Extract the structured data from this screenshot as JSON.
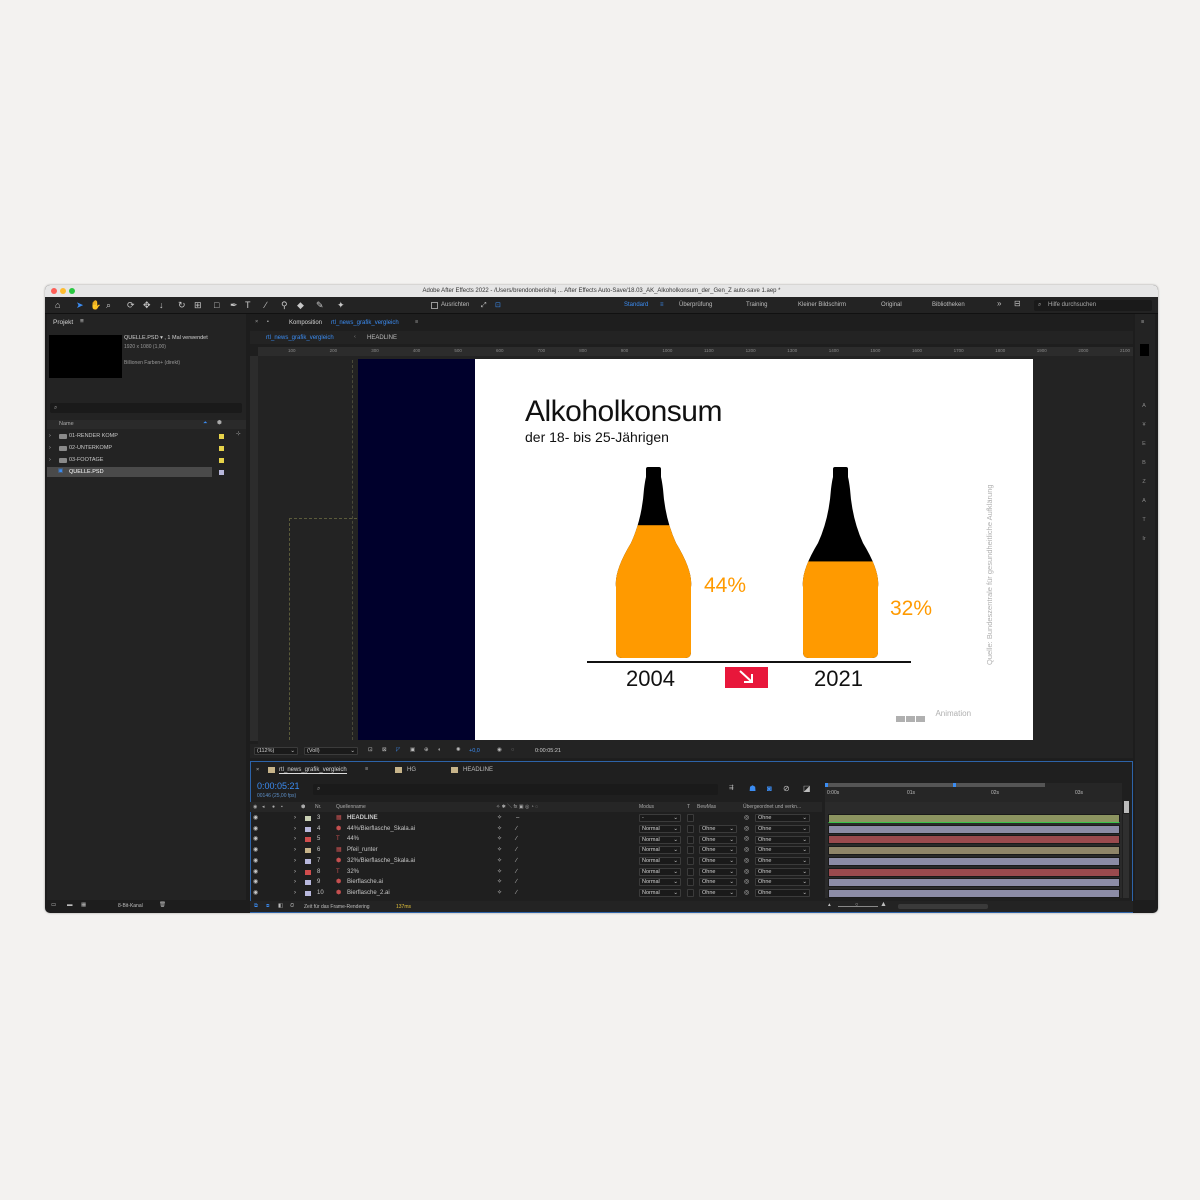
{
  "window": {
    "title": "Adobe After Effects 2022 - /Users/brendonberishaj ...  After Effects Auto-Save/18.03_AK_Alkoholkonsum_der_Gen_Z auto-save 1.aep *"
  },
  "toolbar": {
    "ausrichten": "Ausrichten",
    "workspaces": [
      "Standard",
      "Überprüfung",
      "Training",
      "Kleiner Bildschirm",
      "Original",
      "Bibliotheken"
    ],
    "help_placeholder": "Hilfe durchsuchen"
  },
  "project": {
    "title": "Projekt",
    "item_name": "QUELLE.PSD ▾ , 1 Mal verwendet",
    "item_size": "1920 x 1080 (1,00)",
    "item_colors": "Billionen Farben+ (direkt)",
    "col_name": "Name",
    "items": [
      "01-RENDER KOMP",
      "02-UNTERKOMP",
      "03-FOOTAGE",
      "QUELLE.PSD"
    ],
    "bit_depth": "8-Bit-Kanal"
  },
  "composition": {
    "panel_label": "Komposition",
    "name": "rtl_news_grafik_vergleich",
    "breadcrumb": [
      "rtl_news_grafik_vergleich",
      "HEADLINE"
    ],
    "ruler_labels": [
      "100",
      "200",
      "300",
      "400",
      "500",
      "600",
      "700",
      "800",
      "900",
      "1000",
      "1100",
      "1200",
      "1300",
      "1400",
      "1500",
      "1600",
      "1700",
      "1800",
      "1900",
      "2000",
      "2100"
    ],
    "zoom": "(112%)",
    "resolution": "(Voll)",
    "exposure": "+0,0",
    "timecode": "0:00:05:21"
  },
  "graphic": {
    "title": "Alkoholkonsum",
    "subtitle": "der 18- bis 25-Jährigen",
    "bottles": [
      {
        "year": "2004",
        "percent_label": "44%",
        "fill": 0.44
      },
      {
        "year": "2021",
        "percent_label": "32%",
        "fill": 0.32
      }
    ],
    "source": "Quelle: Bundeszentrale für gesundheitliche Aufklärung",
    "logo_text": "Animation",
    "colors": {
      "orange": "#ff9a00",
      "bottle": "#000000",
      "arrow_box": "#e8173b",
      "background": "#ffffff",
      "comp_bg": "#00002c"
    }
  },
  "timeline": {
    "tabs": [
      "rtl_news_grafik_vergleich",
      "HG",
      "HEADLINE"
    ],
    "timecode": "0:00:05:21",
    "fps": "00146 (25,00 fps)",
    "headers": {
      "nr": "Nr.",
      "source": "Quellenname",
      "mode": "Modus",
      "t": "T",
      "bewmas": "BewMas",
      "parent": "Übergeordnet und verkn..."
    },
    "time_markers": [
      "0:00s",
      "01s",
      "02s",
      "03s"
    ],
    "layers": [
      {
        "nr": "3",
        "name": "HEADLINE",
        "color": "#c9d0b4",
        "type": "comp",
        "mode": "-",
        "bewmas": "",
        "parent": "Ohne",
        "bar": "#8c9460"
      },
      {
        "nr": "4",
        "name": "44%/Bierflasche_Skala.ai",
        "color": "#b8b8dc",
        "type": "ai",
        "mode": "Normal",
        "bewmas": "Ohne",
        "parent": "Ohne",
        "bar": "#8c8ca6"
      },
      {
        "nr": "5",
        "name": "44%",
        "color": "#d04d4d",
        "type": "text",
        "mode": "Normal",
        "bewmas": "Ohne",
        "parent": "Ohne",
        "bar": "#9a4a4e"
      },
      {
        "nr": "6",
        "name": "Pfeil_runter",
        "color": "#c7b48a",
        "type": "comp",
        "mode": "Normal",
        "bewmas": "Ohne",
        "parent": "Ohne",
        "bar": "#8f8569"
      },
      {
        "nr": "7",
        "name": "32%/Bierflasche_Skala.ai",
        "color": "#b8b8dc",
        "type": "ai",
        "mode": "Normal",
        "bewmas": "Ohne",
        "parent": "Ohne",
        "bar": "#8c8ca6"
      },
      {
        "nr": "8",
        "name": "32%",
        "color": "#d04d4d",
        "type": "text",
        "mode": "Normal",
        "bewmas": "Ohne",
        "parent": "Ohne",
        "bar": "#9a4a4e"
      },
      {
        "nr": "9",
        "name": "Bierflasche.ai",
        "color": "#b8b8dc",
        "type": "ai",
        "mode": "Normal",
        "bewmas": "Ohne",
        "parent": "Ohne",
        "bar": "#8c8ca6"
      },
      {
        "nr": "10",
        "name": "Bierflasche_2.ai",
        "color": "#b8b8dc",
        "type": "ai",
        "mode": "Normal",
        "bewmas": "Ohne",
        "parent": "Ohne",
        "bar": "#8c8ca6"
      }
    ],
    "render_time_label": "Zeit für das Frame-Rendering",
    "render_time_value": "137ms"
  },
  "right_panel": {
    "letters": [
      "A",
      "¥",
      "E",
      "B",
      "Z",
      "A",
      "T",
      "Ir"
    ]
  }
}
